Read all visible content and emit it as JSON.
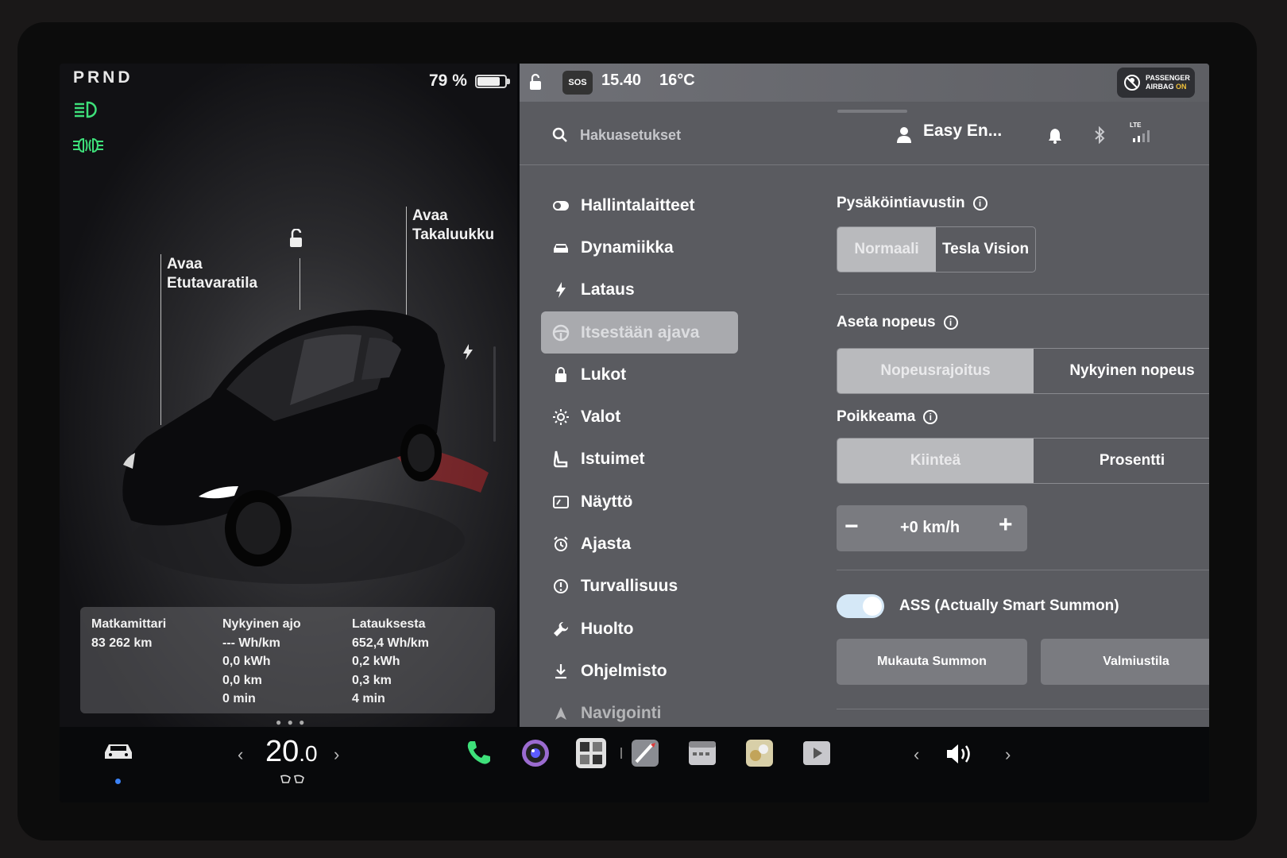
{
  "left": {
    "gear": "PRND",
    "battery": "79 %",
    "frunk_label_1": "Avaa",
    "frunk_label_2": "Etutavaratila",
    "trunk_label_1": "Avaa",
    "trunk_label_2": "Takaluukku",
    "stats": {
      "odometer_title": "Matkamittari",
      "odometer_value": "83 262 km",
      "trip_title": "Nykyinen ajo",
      "trip_lines": [
        "--- Wh/km",
        "0,0 kWh",
        "0,0 km",
        "0 min"
      ],
      "charge_title": "Latauksesta",
      "charge_lines": [
        "652,4 Wh/km",
        "0,2 kWh",
        "0,3 km",
        "4 min"
      ]
    }
  },
  "status": {
    "sos": "SOS",
    "time": "15.40",
    "outside_temp": "16°C",
    "airbag_line1": "PASSENGER",
    "airbag_line2": "AIRBAG",
    "airbag_state": "ON"
  },
  "search": {
    "placeholder": "Hakuasetukset"
  },
  "profile": {
    "name": "Easy En..."
  },
  "lte": "LTE",
  "menu": [
    {
      "label": "Hallintalaitteet",
      "icon": "toggle-icon"
    },
    {
      "label": "Dynamiikka",
      "icon": "car-icon"
    },
    {
      "label": "Lataus",
      "icon": "lightning-icon"
    },
    {
      "label": "Itsestään ajava",
      "icon": "steering-wheel-icon",
      "active": true
    },
    {
      "label": "Lukot",
      "icon": "lock-icon"
    },
    {
      "label": "Valot",
      "icon": "sun-icon"
    },
    {
      "label": "Istuimet",
      "icon": "seat-icon"
    },
    {
      "label": "Näyttö",
      "icon": "display-icon"
    },
    {
      "label": "Ajasta",
      "icon": "alarm-icon"
    },
    {
      "label": "Turvallisuus",
      "icon": "alert-icon"
    },
    {
      "label": "Huolto",
      "icon": "wrench-icon"
    },
    {
      "label": "Ohjelmisto",
      "icon": "download-icon"
    },
    {
      "label": "Navigointi",
      "icon": "navigation-icon"
    }
  ],
  "settings": {
    "parking_title": "Pysäköintiavustin",
    "parking_options": [
      "Normaali",
      "Tesla Vision"
    ],
    "speed_title": "Aseta nopeus",
    "speed_options": [
      "Nopeusrajoitus",
      "Nykyinen nopeus"
    ],
    "offset_title": "Poikkeama",
    "offset_options": [
      "Kiinteä",
      "Prosentti"
    ],
    "offset_value": "+0 km/h",
    "stepper_minus": "−",
    "stepper_plus": "+",
    "summon_toggle_label": "ASS (Actually Smart Summon)",
    "summon_toggle_on": true,
    "customize_summon": "Mukauta Summon",
    "standby": "Valmiustila"
  },
  "dock": {
    "temp_int": "20",
    "temp_dec": ".0",
    "left_chevron": "‹",
    "right_chevron": "›"
  },
  "colors": {
    "green_indicator": "#3ee07a",
    "accent_toggle": "#d5e8f7"
  }
}
